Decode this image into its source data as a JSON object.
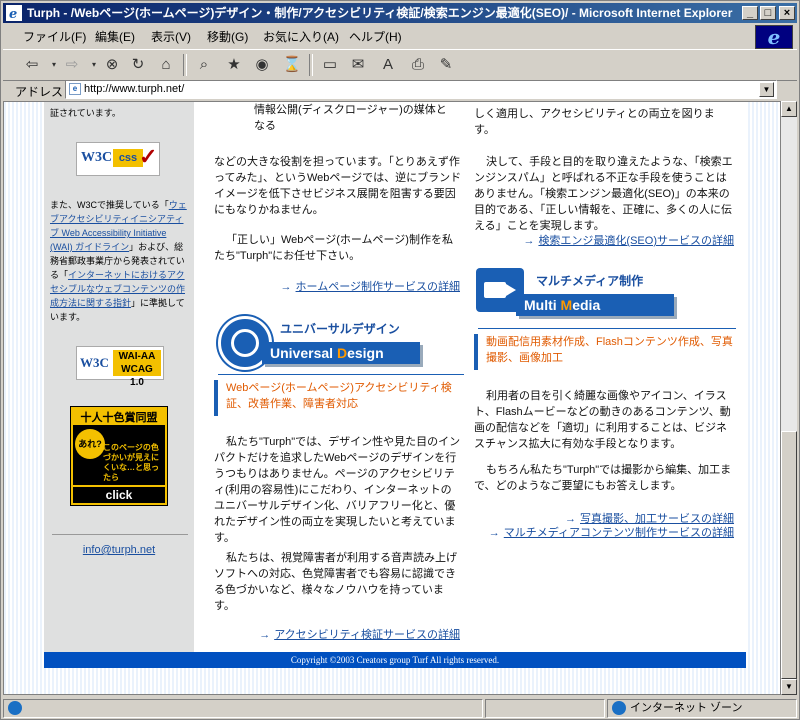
{
  "window": {
    "title": "Turph - /Webページ(ホームページ)デザイン・制作/アクセシビリティ検証/検索エンジン最適化(SEO)/ - Microsoft Internet Explorer",
    "controls": [
      "_",
      "□",
      "×"
    ]
  },
  "menu": [
    "ファイル(F)",
    "編集(E)",
    "表示(V)",
    "移動(G)",
    "お気に入り(A)",
    "ヘルプ(H)"
  ],
  "address": {
    "label": "アドレス",
    "url": "http://www.turph.net/"
  },
  "left": {
    "top_text": "証されています。",
    "css_badge": {
      "w3c": "W3C",
      "css": "css"
    },
    "p1_pre": "また、W3Cで推奨している「",
    "p1_link1": "ウェブアクセシビリティイニシアティブ Web Accessibility Initiative (WAI) ガイドライン",
    "p1_mid": "」および、総務省郵政事業庁から発表されている「",
    "p1_link2": "インターネットにおけるアクセシブルなウェブコンテンツの作成方法に関する指針",
    "p1_post": "」に準拠しています。",
    "aa_badge": {
      "w3c": "W3C",
      "line1": "WAI-AA",
      "line2": "WCAG 1.0"
    },
    "banner": {
      "title": "十人十色賞同盟",
      "bubble": "あれ?",
      "msg": "このページの色づかいが見えにくいな…と思ったら",
      "click": "click"
    },
    "email": "info@turph.net"
  },
  "col1": {
    "p0": "情報公開(ディスクロージャー)の媒体となる",
    "p1": "などの大きな役割を担っています。「とりあえず作ってみた」、というWebページでは、逆にブランドイメージを低下させビジネス展開を阻害する要因にもなりかねません。",
    "p2": "「正しい」Webページ(ホームページ)制作を私たち\"Turph\"にお任せ下さい。",
    "link1": "ホームページ制作サービスの詳細",
    "logo_jp": "ユニバーサルデザイン",
    "logo_en_a": "Universal ",
    "logo_en_b": "D",
    "logo_en_c": "esign",
    "section": "Webページ(ホームページ)アクセシビリティ検証、改善作業、障害者対応",
    "p3": "私たち\"Turph\"では、デザイン性や見た目のインパクトだけを追求したWebページのデザインを行うつもりはありません。ページのアクセシビリティ(利用の容易性)にこだわり、インターネットのユニバーサルデザイン化、バリアフリー化と、優れたデザイン性の両立を実現したいと考えています。",
    "p4": "私たちは、視覚障害者が利用する音声読み上げソフトへの対応、色覚障害者でも容易に認識できる色づかいなど、様々なノウハウを持っています。",
    "link2": "アクセシビリティ検証サービスの詳細"
  },
  "col2": {
    "p0": "しく適用し、アクセシビリティとの両立を図ります。",
    "p1": "決して、手段と目的を取り違えたような、「検索エンジンスパム」と呼ばれる不正な手段を使うことはありません。「検索エンジン最適化(SEO)」の本来の目的である、「正しい情報を、正確に、多くの人に伝える」ことを実現します。",
    "link1": "検索エンジ最適化(SEO)サービスの詳細",
    "logo_jp": "マルチメディア制作",
    "logo_en_a": "Multi ",
    "logo_en_b": "M",
    "logo_en_c": "edia",
    "section": "動画配信用素材作成、Flashコンテンツ作成、写真撮影、画像加工",
    "p2": "利用者の目を引く綺麗な画像やアイコン、イラスト、Flashムービーなどの動きのあるコンテンツ、動画の配信などを「適切」に利用することは、ビジネスチャンス拡大に有効な手段となります。",
    "p3": "もちろん私たち\"Turph\"では撮影から編集、加工まで、どのようなご要望にもお答えします。",
    "link2": "写真撮影、加工サービスの詳細",
    "link3": "マルチメディアコンテンツ制作サービスの詳細"
  },
  "footer": "Copyright ©2003 Creators group Turf All rights reserved.",
  "status": {
    "zone": "インターネット ゾーン"
  }
}
